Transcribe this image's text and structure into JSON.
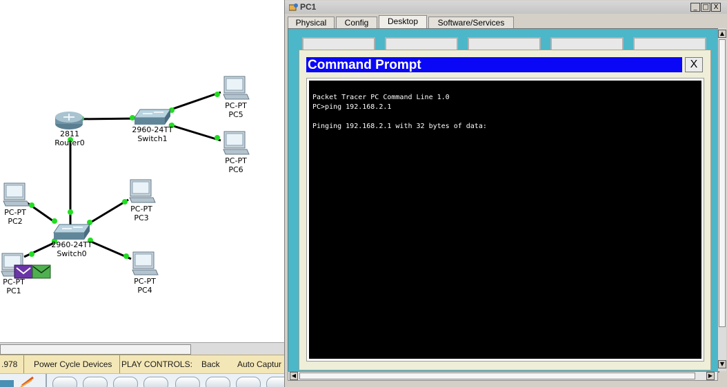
{
  "workspace": {
    "devices": [
      {
        "model": "2811",
        "name": "Router0"
      },
      {
        "model": "2960-24TT",
        "name": "Switch1"
      },
      {
        "model": "2960-24TT",
        "name": "Switch0"
      },
      {
        "model": "PC-PT",
        "name": "PC5"
      },
      {
        "model": "PC-PT",
        "name": "PC6"
      },
      {
        "model": "PC-PT",
        "name": "PC2"
      },
      {
        "model": "PC-PT",
        "name": "PC3"
      },
      {
        "model": "PC-PT",
        "name": "PC1"
      },
      {
        "model": "PC-PT",
        "name": "PC4"
      }
    ],
    "link_color": "#000000",
    "link_dot_color": "#22dd22"
  },
  "status_bar": {
    "time_fragment": ".978",
    "power_cycle": "Power Cycle Devices",
    "play_controls": "PLAY CONTROLS:",
    "back": "Back",
    "auto_capture": "Auto Captur"
  },
  "pc_window": {
    "title": "PC1",
    "window_buttons": {
      "minimize": "_",
      "maximize": "□",
      "close": "X"
    },
    "tabs": [
      "Physical",
      "Config",
      "Desktop",
      "Software/Services"
    ],
    "active_tab": "Desktop",
    "panel_color": "#4cb7c8"
  },
  "command_prompt": {
    "title": "Command Prompt",
    "close_label": "X",
    "title_bar_color": "#0a07f7",
    "output": "Packet Tracer PC Command Line 1.0\nPC>ping 192.168.2.1\n\nPinging 192.168.2.1 with 32 bytes of data:"
  }
}
